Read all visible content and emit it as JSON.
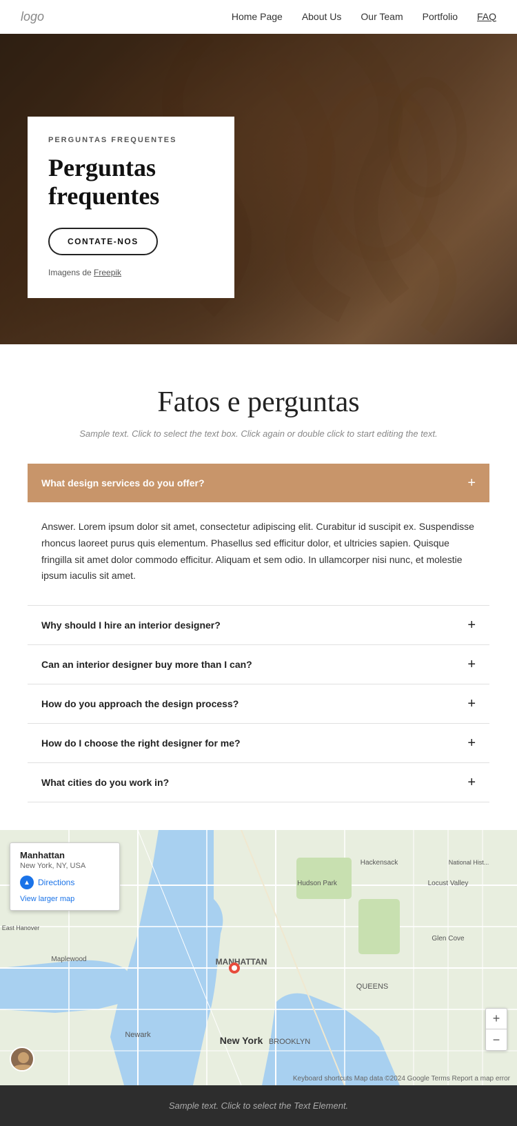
{
  "nav": {
    "logo": "logo",
    "links": [
      {
        "label": "Home Page",
        "href": "#",
        "active": false
      },
      {
        "label": "About Us",
        "href": "#",
        "active": false
      },
      {
        "label": "Our Team",
        "href": "#",
        "active": false
      },
      {
        "label": "Portfolio",
        "href": "#",
        "active": false
      },
      {
        "label": "FAQ",
        "href": "#",
        "active": true
      }
    ]
  },
  "hero": {
    "subtitle": "PERGUNTAS FREQUENTES",
    "title": "Perguntas frequentes",
    "cta_label": "CONTATE-NOS",
    "credit_text": "Imagens de ",
    "credit_link": "Freepik"
  },
  "faq_section": {
    "title": "Fatos e perguntas",
    "sample_text": "Sample text. Click to select the text box. Click again or double click to start editing the text.",
    "items": [
      {
        "question": "What design services do you offer?",
        "answer": "Answer. Lorem ipsum dolor sit amet, consectetur adipiscing elit. Curabitur id suscipit ex. Suspendisse rhoncus laoreet purus quis elementum. Phasellus sed efficitur dolor, et ultricies sapien. Quisque fringilla sit amet dolor commodo efficitur. Aliquam et sem odio. In ullamcorper nisi nunc, et molestie ipsum iaculis sit amet.",
        "active": true
      },
      {
        "question": "Why should I hire an interior designer?",
        "answer": "",
        "active": false
      },
      {
        "question": "Can an interior designer buy more than I can?",
        "answer": "",
        "active": false
      },
      {
        "question": "How do you approach the design process?",
        "answer": "",
        "active": false
      },
      {
        "question": "How do I choose the right designer for me?",
        "answer": "",
        "active": false
      },
      {
        "question": "What cities do you work in?",
        "answer": "",
        "active": false
      }
    ]
  },
  "map": {
    "place_name": "Manhattan",
    "place_sub": "New York, NY, USA",
    "directions_label": "Directions",
    "view_larger_label": "View larger map",
    "zoom_in": "+",
    "zoom_out": "−",
    "credits": "Keyboard shortcuts  Map data ©2024 Google  Terms  Report a map error"
  },
  "footer": {
    "sample_text": "Sample text. Click to select the Text Element."
  }
}
